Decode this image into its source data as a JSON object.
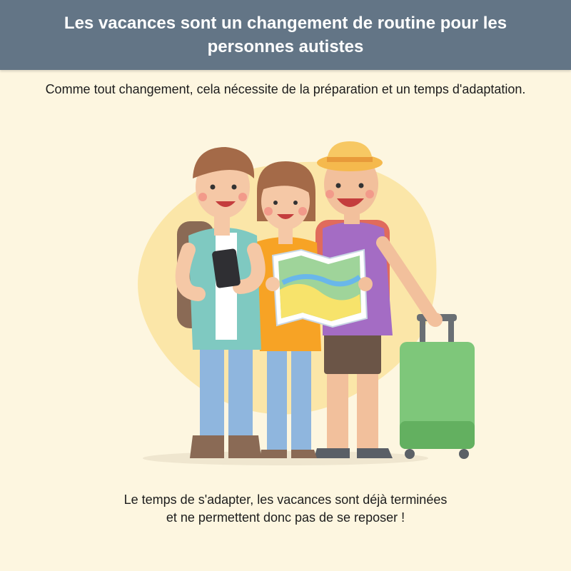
{
  "header": {
    "title": "Les vacances sont un changement de routine pour les personnes autistes"
  },
  "intro": {
    "text": "Comme tout changement, cela nécessite de la préparation et un temps d'adaptation."
  },
  "illustration": {
    "subject": "three travelers with a map, phone and suitcase",
    "colors": {
      "background_blob": "#fbe6a8",
      "suitcase": "#7ec77a",
      "shirt_orange": "#f7a325",
      "shirt_purple": "#a46cc4",
      "shirt_teal": "#7fc9c1",
      "hat": "#f5b94d"
    }
  },
  "footer": {
    "line1": "Le temps de s'adapter, les vacances sont déjà terminées",
    "line2": "et ne permettent donc pas de se reposer !"
  }
}
